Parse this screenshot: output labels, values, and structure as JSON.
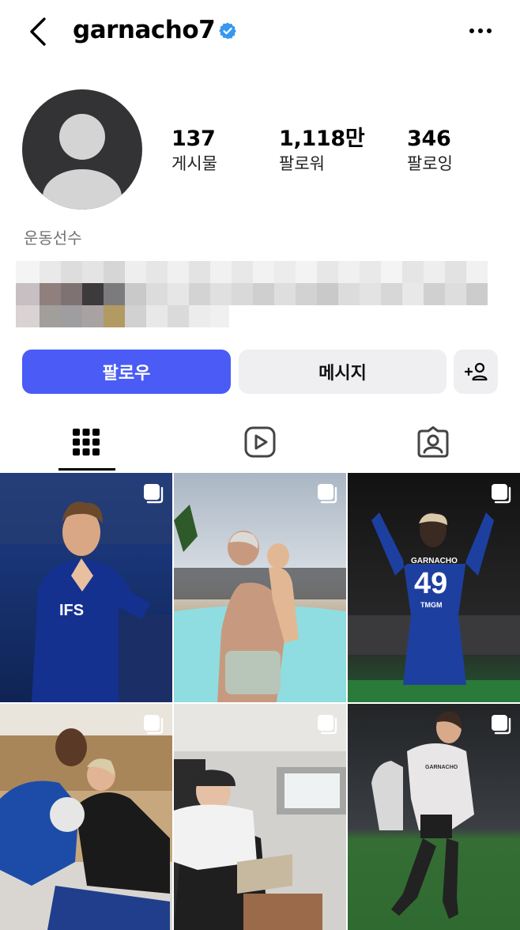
{
  "header": {
    "username": "garnacho7",
    "back_icon": "chevron-left-icon",
    "verified_icon": "verified-badge-icon",
    "more_icon": "more-horizontal-icon"
  },
  "profile": {
    "stats": [
      {
        "value": "137",
        "label": "게시물"
      },
      {
        "value": "1,118만",
        "label": "팔로워"
      },
      {
        "value": "346",
        "label": "팔로잉"
      }
    ],
    "category": "운동선수"
  },
  "actions": {
    "follow_label": "팔로우",
    "message_label": "메시지",
    "suggest_icon": "add-person-icon"
  },
  "tabs": [
    {
      "name": "posts",
      "icon": "grid-icon",
      "active": true
    },
    {
      "name": "reels",
      "icon": "reels-play-icon",
      "active": false
    },
    {
      "name": "tagged",
      "icon": "tagged-person-icon",
      "active": false
    }
  ],
  "grid": {
    "posts": [
      {
        "jersey_text": "IFS",
        "multi_icon": "carousel-icon"
      },
      {
        "multi_icon": "carousel-icon"
      },
      {
        "jersey_name": "GARNACHO",
        "jersey_number": "49",
        "sponsor": "TMGM",
        "multi_icon": "carousel-icon"
      },
      {
        "multi_icon": "carousel-icon"
      },
      {
        "multi_icon": "carousel-icon"
      },
      {
        "jersey_name": "GARNACHO",
        "multi_icon": "carousel-icon"
      }
    ]
  },
  "colors": {
    "follow_button": "#4a5cf5",
    "secondary_button": "#efeff1",
    "verified": "#3897f0",
    "category_text": "#737373"
  }
}
